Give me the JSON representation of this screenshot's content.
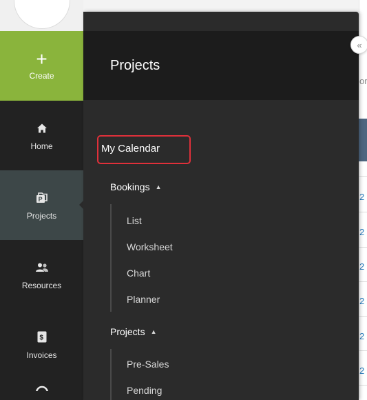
{
  "rail": {
    "items": [
      {
        "label": "Create",
        "icon": "plus-icon"
      },
      {
        "label": "Home",
        "icon": "home-icon"
      },
      {
        "label": "Projects",
        "icon": "projects-icon"
      },
      {
        "label": "Resources",
        "icon": "people-icon"
      },
      {
        "label": "Invoices",
        "icon": "invoice-icon"
      }
    ]
  },
  "panel": {
    "title": "Projects",
    "my_calendar": "My Calendar",
    "bookings": {
      "label": "Bookings",
      "items": [
        "List",
        "Worksheet",
        "Chart",
        "Planner"
      ]
    },
    "projects": {
      "label": "Projects",
      "items": [
        "Pre-Sales",
        "Pending"
      ]
    }
  },
  "background": {
    "partial_header_text": "or",
    "row_digit": "2"
  },
  "colors": {
    "create_green": "#8ab43c",
    "rail_dark": "#222222",
    "rail_active": "#3d4748",
    "panel_bg": "#2b2b2b",
    "panel_header": "#1c1c1c",
    "highlight_red": "#e0303a",
    "link_blue": "#2a7fc1"
  }
}
